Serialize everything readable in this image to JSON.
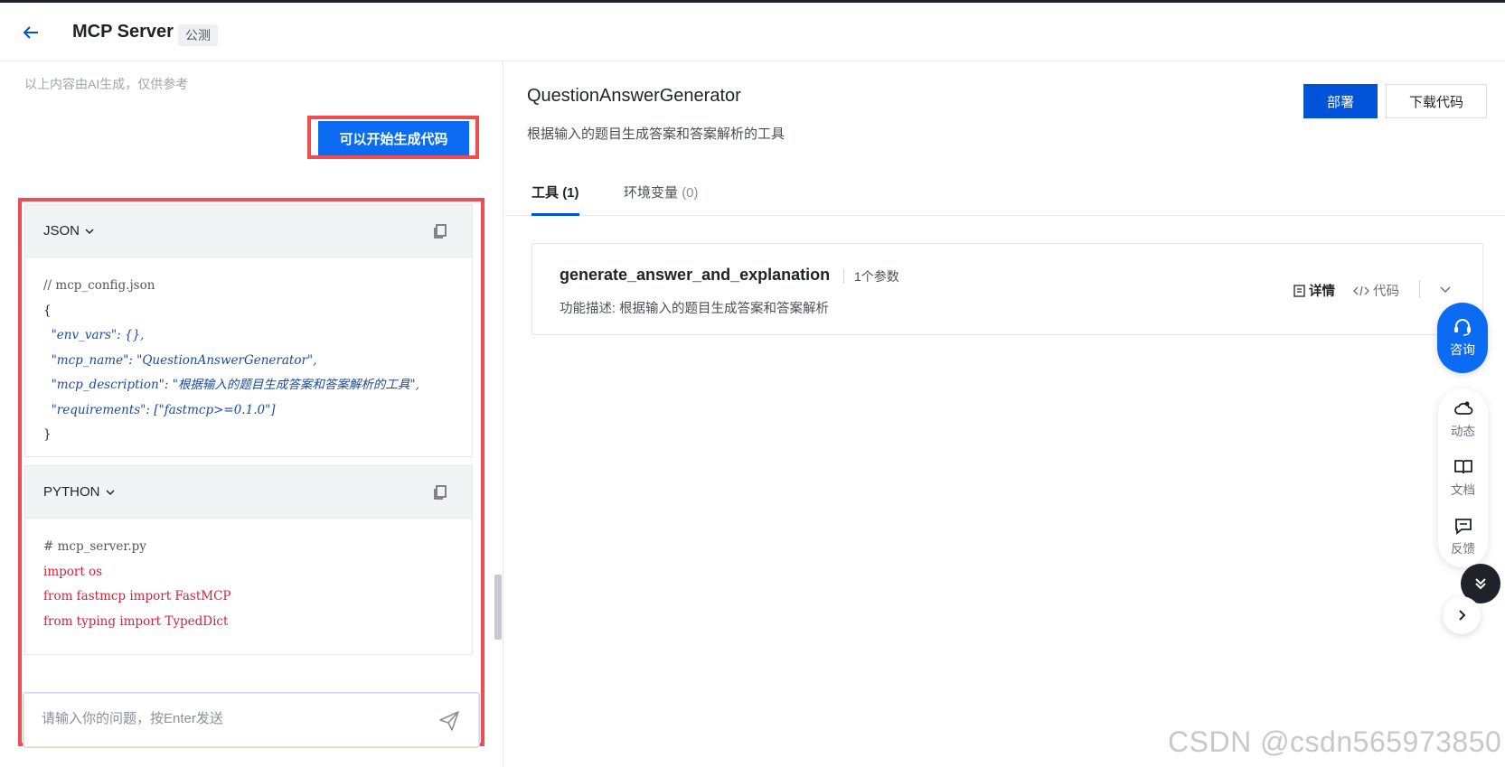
{
  "header": {
    "title": "MCP Server",
    "badge": "公测"
  },
  "left": {
    "ai_note": "以上内容由AI生成，仅供参考",
    "generate_button": "可以开始生成代码",
    "json_block": {
      "lang": "JSON",
      "lines": [
        "// mcp_config.json",
        "{",
        "  \"env_vars\": {},",
        "  \"mcp_name\": \"QuestionAnswerGenerator\",",
        "  \"mcp_description\": \"根据输入的题目生成答案和答案解析的工具\",",
        "  \"requirements\": [\"fastmcp>=0.1.0\"]",
        "}"
      ]
    },
    "python_block": {
      "lang": "PYTHON",
      "lines": [
        "# mcp_server.py",
        "import os",
        "from fastmcp import FastMCP",
        "from typing import TypedDict"
      ]
    },
    "chat_placeholder": "请输入你的问题，按Enter发送"
  },
  "right": {
    "title": "QuestionAnswerGenerator",
    "description": "根据输入的题目生成答案和答案解析的工具",
    "deploy_button": "部署",
    "download_button": "下载代码",
    "tabs": [
      {
        "label": "工具",
        "count": "(1)"
      },
      {
        "label": "环境变量",
        "count": "(0)"
      }
    ],
    "tool": {
      "name": "generate_answer_and_explanation",
      "params": "1个参数",
      "description": "功能描述: 根据输入的题目生成答案和答案解析",
      "detail_label": "详情",
      "code_label": "代码"
    }
  },
  "side": {
    "consult": "咨询",
    "items": [
      "动态",
      "文档",
      "反馈"
    ]
  },
  "watermark": "CSDN @csdn565973850"
}
